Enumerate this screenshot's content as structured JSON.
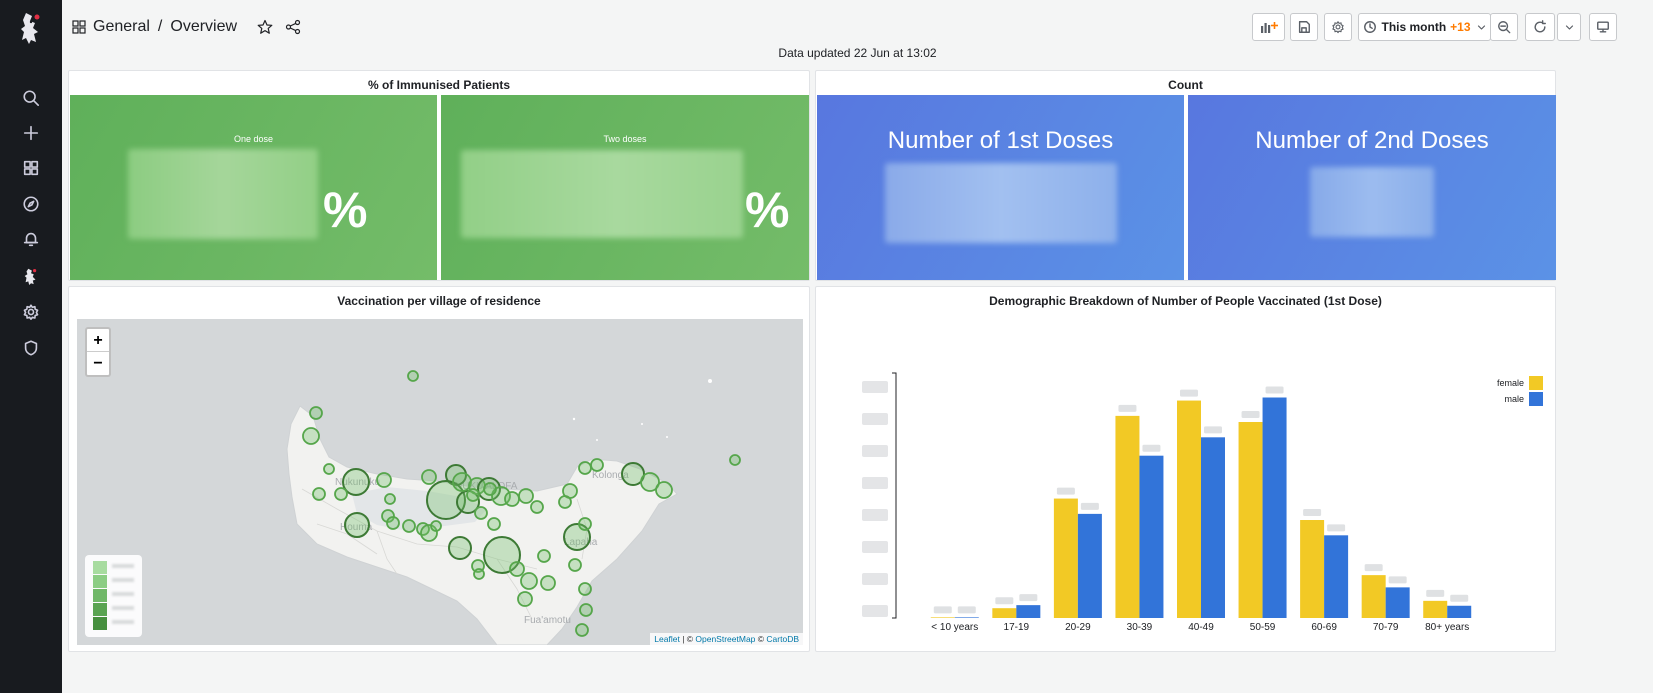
{
  "app": {
    "breadcrumb": {
      "folder": "General",
      "separator": "/",
      "dashboard": "Overview"
    },
    "updated_text": "Data updated 22 Jun at 13:02",
    "toolbar": {
      "time_range": "This month",
      "time_offset": "+13"
    }
  },
  "sidebar": {
    "items": [
      {
        "icon": "search-icon"
      },
      {
        "icon": "plus-icon"
      },
      {
        "icon": "dashboards-icon"
      },
      {
        "icon": "explore-icon"
      },
      {
        "icon": "alerting-icon"
      },
      {
        "icon": "app-plugin-icon"
      },
      {
        "icon": "gear-icon"
      },
      {
        "icon": "shield-icon"
      }
    ]
  },
  "panels": {
    "immunised": {
      "title": "% of Immunised Patients",
      "stats": [
        {
          "label": "One dose",
          "unit": "%"
        },
        {
          "label": "Two doses",
          "unit": "%"
        }
      ]
    },
    "count": {
      "title": "Count",
      "stats": [
        {
          "label": "Number of 1st Doses"
        },
        {
          "label": "Number of 2nd Doses"
        }
      ]
    },
    "map": {
      "title": "Vaccination per village of residence",
      "zoom_in": "+",
      "zoom_out": "−",
      "attribution": {
        "leaflet": "Leaflet",
        "sep1": " | © ",
        "osm": "OpenStreetMap",
        "sep2": " © ",
        "carto": "CartoDB"
      }
    }
  },
  "colors": {
    "female": "#f2c925",
    "male": "#3274d9",
    "stat_green": "#6bb862",
    "stat_blue": "#5a85e2"
  },
  "chart_data": {
    "type": "bar",
    "title": "Demographic Breakdown of Number of People Vaccinated (1st Dose)",
    "categories": [
      "< 10 years",
      "17-19",
      "20-29",
      "30-39",
      "40-49",
      "50-59",
      "60-69",
      "70-79",
      "80+ years"
    ],
    "series": [
      {
        "name": "female",
        "values": [
          0.2,
          3.2,
          39,
          66,
          71,
          64,
          32,
          14,
          5.6
        ]
      },
      {
        "name": "male",
        "values": [
          0.2,
          4.2,
          34,
          53,
          59,
          72,
          27,
          10,
          4.0
        ]
      }
    ],
    "ylim": [
      0,
      80
    ],
    "grid": false,
    "legend": "top-right",
    "note": "y-axis tick labels and data labels are blurred in the screenshot; values estimated from bar heights"
  }
}
